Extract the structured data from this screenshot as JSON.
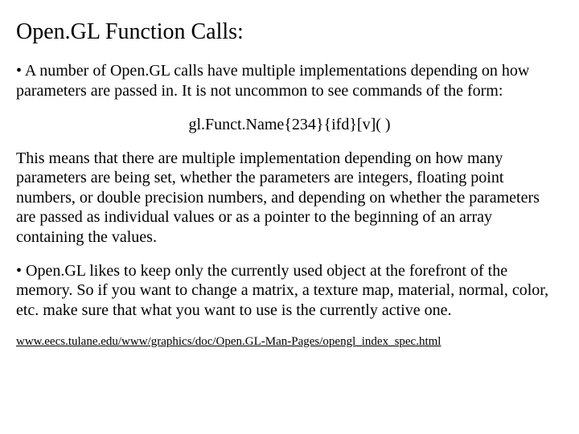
{
  "title": "Open.GL Function Calls:",
  "bullet1": "• A number of Open.GL calls have multiple implementations depending on how parameters are passed in. It is not uncommon to see commands of the form:",
  "codeLine": "gl.Funct.Name{234}{ifd}[v]( )",
  "para2": "This means that there are multiple implementation depending on how many parameters are being set, whether the parameters are integers, floating point numbers, or double precision numbers, and depending on whether the parameters are passed as individual values or as a pointer to the beginning of an array containing the values.",
  "bullet2": "• Open.GL likes to keep only the currently used object at the forefront of the memory. So if you want to change a matrix, a texture map, material, normal, color, etc. make sure that what you want to use is the currently active one.",
  "footer": "www.eecs.tulane.edu/www/graphics/doc/Open.GL-Man-Pages/opengl_index_spec.html"
}
